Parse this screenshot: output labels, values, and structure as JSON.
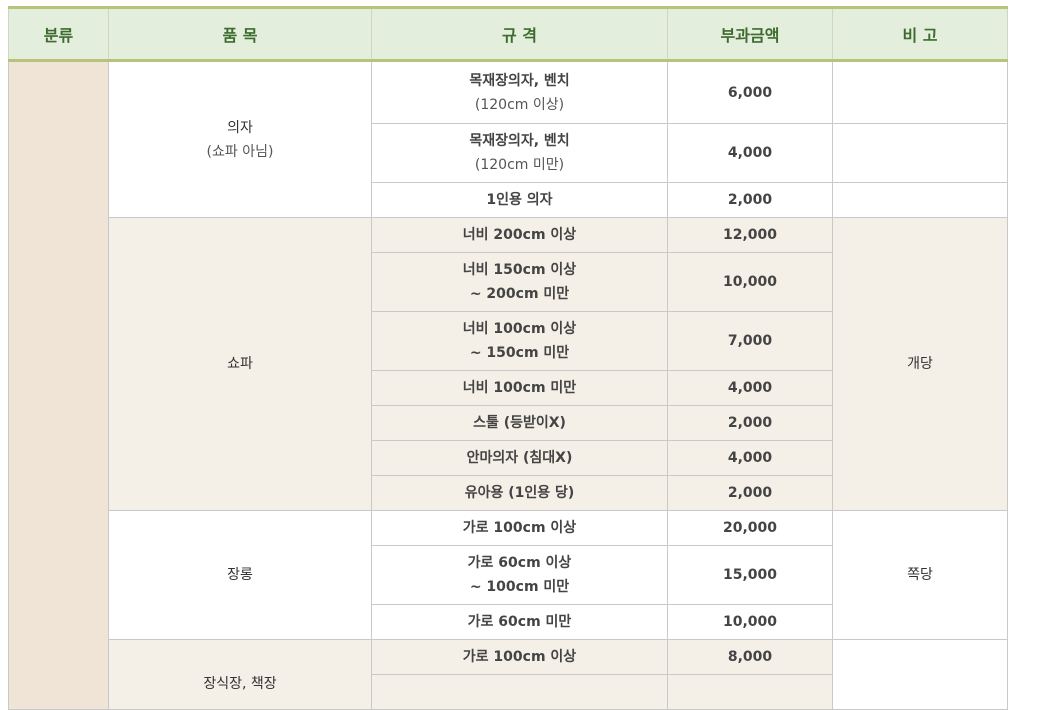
{
  "headers": {
    "category": "분류",
    "item": "품 목",
    "spec": "규 격",
    "amount": "부과금액",
    "note": "비 고"
  },
  "groups": {
    "chair": {
      "name": "의자",
      "sub": "(쇼파 아님)",
      "rows": [
        {
          "spec": "목재장의자, 벤치",
          "spec2": "(120cm 이상)",
          "amount": "6,000"
        },
        {
          "spec": "목재장의자, 벤치",
          "spec2": "(120cm 미만)",
          "amount": "4,000"
        },
        {
          "spec": "1인용 의자",
          "amount": "2,000"
        }
      ]
    },
    "sofa": {
      "name": "쇼파",
      "note": "개당",
      "rows": [
        {
          "spec": "너비 200cm 이상",
          "amount": "12,000"
        },
        {
          "spec": "너비 150cm 이상",
          "spec2": "~ 200cm 미만",
          "amount": "10,000"
        },
        {
          "spec": "너비 100cm 이상",
          "spec2": "~ 150cm 미만",
          "amount": "7,000"
        },
        {
          "spec": "너비 100cm 미만",
          "amount": "4,000"
        },
        {
          "spec": "스툴 (등받이X)",
          "amount": "2,000"
        },
        {
          "spec": "안마의자 (침대X)",
          "amount": "4,000"
        },
        {
          "spec": "유아용 (1인용 당)",
          "amount": "2,000"
        }
      ]
    },
    "wardrobe": {
      "name": "장롱",
      "note": "쪽당",
      "rows": [
        {
          "spec": "가로 100cm 이상",
          "amount": "20,000"
        },
        {
          "spec": "가로 60cm 이상",
          "spec2": "~ 100cm 미만",
          "amount": "15,000"
        },
        {
          "spec": "가로 60cm 미만",
          "amount": "10,000"
        }
      ]
    },
    "shelf": {
      "name": "장식장, 책장",
      "rows": [
        {
          "spec": "가로 100cm 이상",
          "amount": "8,000"
        }
      ]
    }
  }
}
